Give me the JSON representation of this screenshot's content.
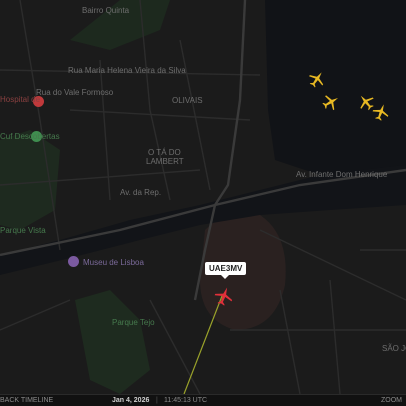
{
  "map": {
    "labels": {
      "road_1": "Rua Maria Helena Vieira da Silva",
      "road_2": "Rua do Vale Formoso",
      "road_3": "Av. da Rep.",
      "road_4": "Av. Infante Dom Henrique",
      "neighborhood": "OLIVAIS",
      "tag_line_1": "O TÁ DO",
      "tag_line_2": "LAMBERT",
      "poi_1": "Hospital de",
      "poi_2": "Cuf Descobertas",
      "poi_3": "Parque Vista",
      "poi_4": "Museu de Lisboa",
      "poi_5": "Parque Tejo",
      "district": "SÃO JOÃO DE DEUS",
      "top_name": "Bairro Quinta"
    },
    "flight": {
      "callsign": "UAE3MV",
      "color": "#e0303a"
    },
    "other_aircraft_color": "#e8b923"
  },
  "bottom_bar": {
    "left": "BACK TIMELINE",
    "date": "Jan 4, 2026",
    "time": "11:45:13 UTC",
    "right": "ZOOM"
  }
}
